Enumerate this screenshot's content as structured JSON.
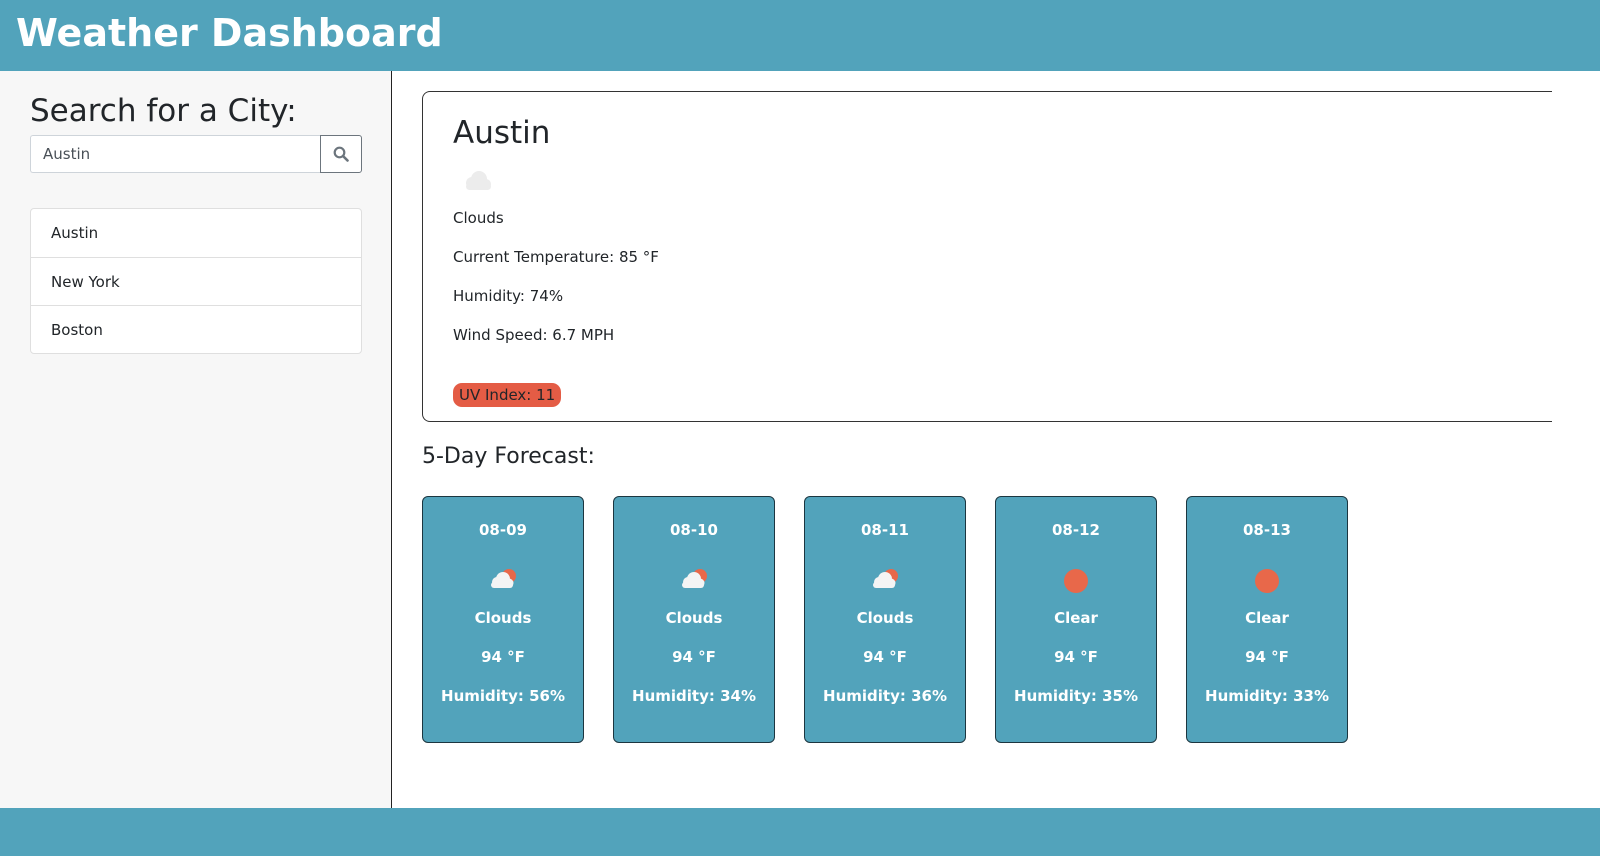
{
  "header": {
    "title": "Weather Dashboard"
  },
  "sidebar": {
    "title": "Search for a City:",
    "search": {
      "value": "Austin",
      "icon": "search-icon"
    },
    "history": [
      "Austin",
      "New York",
      "Boston"
    ]
  },
  "current": {
    "city": "Austin",
    "icon": "cloud-icon",
    "description": "Clouds",
    "temperature": "Current Temperature: 85 °F",
    "humidity": "Humidity: 74%",
    "wind": "Wind Speed: 6.7 MPH",
    "uv": "UV Index: 11",
    "uv_color": "#e45c45"
  },
  "forecast": {
    "title": "5-Day Forecast:",
    "days": [
      {
        "date": "08-09",
        "icon": "cloud-sun-icon",
        "desc": "Clouds",
        "temp": "94 °F",
        "humidity": "Humidity: 56%"
      },
      {
        "date": "08-10",
        "icon": "cloud-sun-icon",
        "desc": "Clouds",
        "temp": "94 °F",
        "humidity": "Humidity: 34%"
      },
      {
        "date": "08-11",
        "icon": "cloud-sun-icon",
        "desc": "Clouds",
        "temp": "94 °F",
        "humidity": "Humidity: 36%"
      },
      {
        "date": "08-12",
        "icon": "sun-icon",
        "desc": "Clear",
        "temp": "94 °F",
        "humidity": "Humidity: 35%"
      },
      {
        "date": "08-13",
        "icon": "sun-icon",
        "desc": "Clear",
        "temp": "94 °F",
        "humidity": "Humidity: 33%"
      }
    ]
  },
  "colors": {
    "brand": "#52a3bb",
    "accent": "#e8684a",
    "sidebar_bg": "#f7f7f7"
  }
}
